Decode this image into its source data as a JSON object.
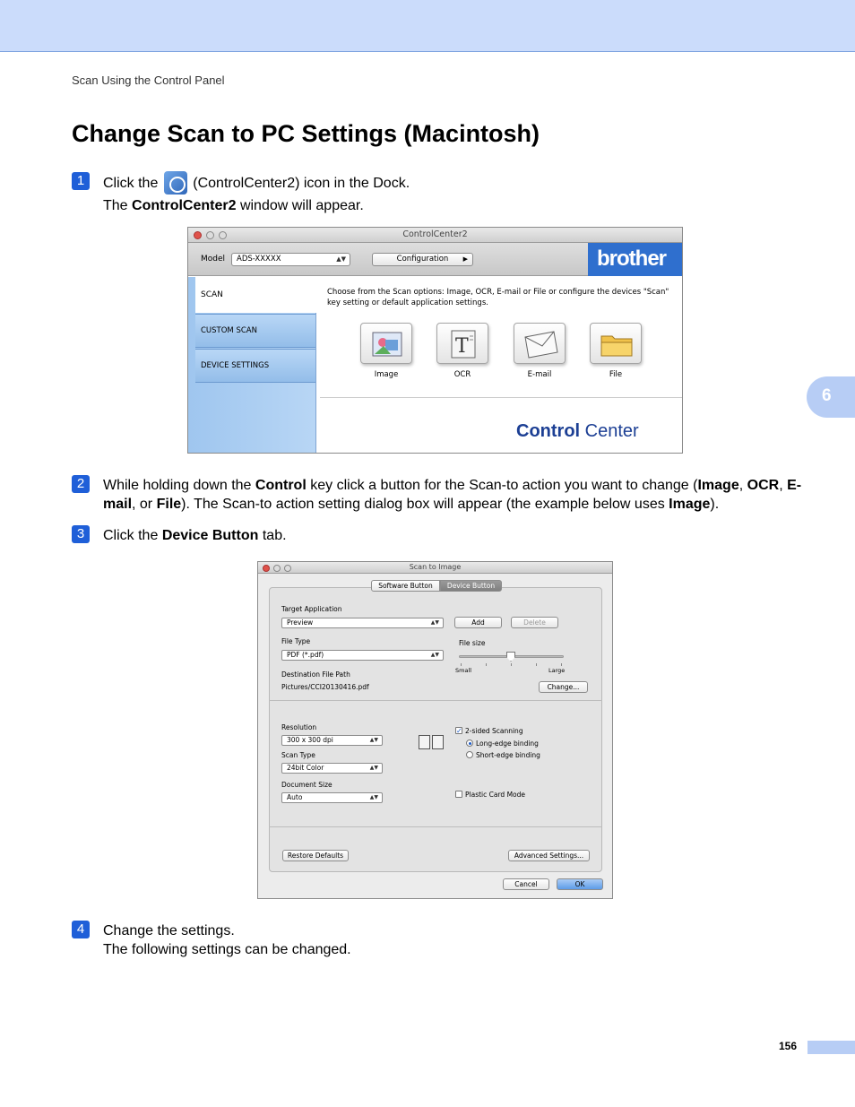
{
  "header": {
    "breadcrumb": "Scan Using the Control Panel"
  },
  "title": "Change Scan to PC Settings (Macintosh)",
  "chapter_tab": "6",
  "steps": [
    {
      "num": "1",
      "line1_pre": "Click the",
      "line1_post": "(ControlCenter2) icon in the Dock.",
      "line2_pre": "The",
      "line2_bold": "ControlCenter2",
      "line2_post": "window will appear."
    },
    {
      "num": "2",
      "t1": "While holding down the",
      "b1": "Control",
      "t2": "key click a button for the Scan-to action you want to change (",
      "b2": "Image",
      "t3": ",",
      "b3": "OCR",
      "t4": ",",
      "b4": "E-mail",
      "t5": ", or",
      "b5": "File",
      "t6": "). The Scan-to action setting dialog box will appear (the example below uses",
      "b6": "Image",
      "t7": ")."
    },
    {
      "num": "3",
      "pre": "Click the",
      "bold": "Device Button",
      "post": "tab."
    },
    {
      "num": "4",
      "line1": "Change the settings.",
      "line2": "The following settings can be changed."
    }
  ],
  "cc_window": {
    "title": "ControlCenter2",
    "model_label": "Model",
    "model_value": "ADS-XXXXX",
    "configuration_label": "Configuration",
    "brand": "brother",
    "tabs": [
      "SCAN",
      "CUSTOM SCAN",
      "DEVICE SETTINGS"
    ],
    "description": "Choose from the Scan options: Image, OCR, E-mail or File or configure the devices \"Scan\" key setting or default application settings.",
    "buttons": [
      "Image",
      "OCR",
      "E-mail",
      "File"
    ],
    "logo_bold": "Control",
    "logo_light": "Center"
  },
  "s2i_window": {
    "title": "Scan to Image",
    "tab_software": "Software Button",
    "tab_device": "Device Button",
    "target_application_label": "Target Application",
    "target_application_value": "Preview",
    "add_label": "Add",
    "delete_label": "Delete",
    "file_type_label": "File Type",
    "file_type_value": "PDF (*.pdf)",
    "file_size_label": "File size",
    "file_size_small": "Small",
    "file_size_large": "Large",
    "destination_label": "Destination File Path",
    "destination_value": "Pictures/CCI20130416.pdf",
    "change_label": "Change...",
    "resolution_label": "Resolution",
    "resolution_value": "300 x 300 dpi",
    "scan_type_label": "Scan Type",
    "scan_type_value": "24bit Color",
    "document_size_label": "Document Size",
    "document_size_value": "Auto",
    "two_sided_label": "2-sided Scanning",
    "long_edge_label": "Long-edge binding",
    "short_edge_label": "Short-edge binding",
    "plastic_card_label": "Plastic Card Mode",
    "restore_label": "Restore Defaults",
    "advanced_label": "Advanced Settings...",
    "cancel_label": "Cancel",
    "ok_label": "OK"
  },
  "footer": {
    "page_number": "156"
  },
  "colors": {
    "accent": "#1f5fd8",
    "band": "#cbdcfb",
    "tab": "#b7cdf5",
    "brand": "#2f6fce"
  }
}
